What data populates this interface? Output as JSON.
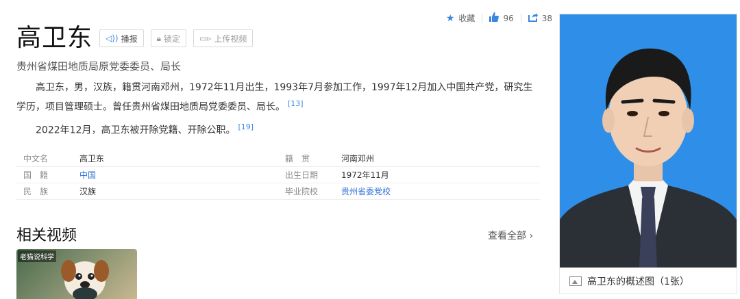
{
  "header": {
    "favorite_label": "收藏",
    "like_count": "96",
    "share_count": "38"
  },
  "title": "高卫东",
  "buttons": {
    "broadcast": "播报",
    "lock": "锁定",
    "upload_video": "上传视频"
  },
  "subtitle": "贵州省煤田地质局原党委委员、局长",
  "paragraphs": [
    {
      "text": "高卫东，男，汉族，籍贯河南邓州，1972年11月出生，1993年7月参加工作，1997年12月加入中国共产党，研究生学历，项目管理硕士。曾任贵州省煤田地质局党委委员、局长。",
      "ref": "[13]"
    },
    {
      "text": "2022年12月，高卫东被开除党籍、开除公职。",
      "ref": "[19]"
    }
  ],
  "info_rows": [
    {
      "label": "中文名",
      "value": "高卫东",
      "label2": "籍　贯",
      "value2": "河南邓州"
    },
    {
      "label": "国　籍",
      "value": "中国",
      "label2": "出生日期",
      "value2": "1972年11月"
    },
    {
      "label": "民　族",
      "value": "汉族",
      "label2": "毕业院校",
      "value2": "贵州省委党校"
    }
  ],
  "related_videos": {
    "title": "相关视频",
    "view_all": "查看全部",
    "thumb_tag": "老猫说科学"
  },
  "photo_caption": "高卫东的概述图（1张）",
  "colors": {
    "accent": "#3b87e0",
    "photo_background": "#2f8fe8"
  }
}
